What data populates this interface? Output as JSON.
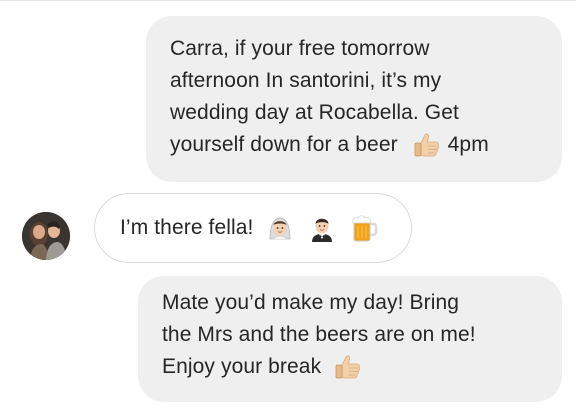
{
  "conversation": {
    "messages": [
      {
        "sender": "self",
        "lines": [
          "Carra, if your free tomorrow",
          "afternoon In santorini, it’s my",
          "wedding day at Rocabella. Get",
          "yourself down for a beer"
        ],
        "after_emoji": "4pm",
        "emojis": [
          "thumbs-up-icon"
        ]
      },
      {
        "sender": "other",
        "text": "I’m there fella!",
        "emojis": [
          "bride-icon",
          "groom-icon",
          "beer-mug-icon"
        ]
      },
      {
        "sender": "self",
        "lines": [
          "Mate you’d make my day! Bring",
          "the Mrs and the beers are on me!",
          "Enjoy your break"
        ],
        "emojis": [
          "thumbs-up-icon"
        ]
      }
    ]
  },
  "colors": {
    "outgoing_bubble": "#efefef",
    "incoming_border": "#dbdbdb",
    "text": "#262626"
  }
}
